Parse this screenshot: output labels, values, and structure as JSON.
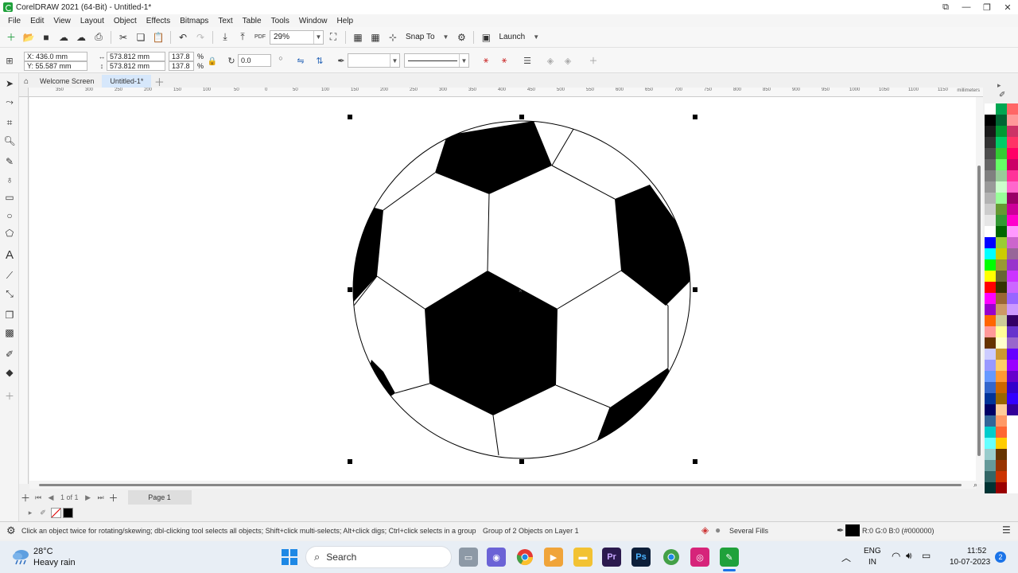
{
  "window": {
    "title": "CorelDRAW 2021 (64-Bit) - Untitled-1*"
  },
  "menu": [
    "File",
    "Edit",
    "View",
    "Layout",
    "Object",
    "Effects",
    "Bitmaps",
    "Text",
    "Table",
    "Tools",
    "Window",
    "Help"
  ],
  "toolbar": {
    "zoom": "29%",
    "snap_to": "Snap To",
    "launch": "Launch",
    "pdf": "PDF"
  },
  "properties": {
    "x": "X: 436.0 mm",
    "y": "Y: 55.587 mm",
    "width": "573.812 mm",
    "height": "573.812 mm",
    "scale_w": "137.8",
    "scale_h": "137.8",
    "pct": "%",
    "angle": "0.0"
  },
  "tabs": {
    "welcome": "Welcome Screen",
    "document": "Untitled-1*"
  },
  "ruler": {
    "labels": [
      "350",
      "300",
      "250",
      "200",
      "150",
      "100",
      "50",
      "0",
      "50",
      "100",
      "150",
      "200",
      "250",
      "300",
      "350",
      "400",
      "450",
      "500",
      "550",
      "600",
      "650",
      "700",
      "750",
      "800",
      "850",
      "900",
      "950",
      "1000",
      "1050",
      "1100",
      "1150"
    ],
    "unit": "millimeters"
  },
  "page_nav": {
    "count": "1 of 1",
    "page": "Page 1"
  },
  "status": {
    "hint": "Click an object twice for rotating/skewing; dbl-clicking tool selects all objects; Shift+click multi-selects; Alt+click digs; Ctrl+click selects in a group",
    "selection": "Group of 2 Objects on Layer 1",
    "fill": "Several Fills",
    "outline": "R:0 G:0 B:0 (#000000)"
  },
  "taskbar": {
    "temp": "28°C",
    "weather": "Heavy rain",
    "search": "Search",
    "lang1": "ENG",
    "lang2": "IN",
    "time": "11:52",
    "date": "10-07-2023",
    "notifications": "2"
  },
  "palette_colors": {
    "col1": [
      "#ffffff",
      "#000000",
      "#1a1a1a",
      "#333333",
      "#4d4d4d",
      "#666666",
      "#808080",
      "#999999",
      "#b3b3b3",
      "#cccccc",
      "#e6e6e6",
      "#ffffff",
      "#0000ff",
      "#00ffff",
      "#00ff00",
      "#ffff00",
      "#ff0000",
      "#ff00ff",
      "#9900cc",
      "#ff6600",
      "#ff9999",
      "#663300",
      "#ccccff",
      "#9999ff",
      "#6699ff",
      "#3366cc",
      "#003399",
      "#000066",
      "#336699",
      "#00cccc",
      "#66ffff",
      "#99cccc",
      "#669999",
      "#336666",
      "#003333"
    ],
    "col2": [
      "#00a651",
      "#006633",
      "#009933",
      "#00cc66",
      "#33cc33",
      "#66ff66",
      "#99cc99",
      "#ccffcc",
      "#99ff99",
      "#669933",
      "#339933",
      "#006600",
      "#99cc33",
      "#cccc00",
      "#999933",
      "#666633",
      "#333300",
      "#996633",
      "#cc9966",
      "#cccc99",
      "#ffff99",
      "#ffffcc",
      "#cc9933",
      "#ffcc66",
      "#ff9933",
      "#cc6600",
      "#996600",
      "#ffcc99",
      "#ff9966",
      "#ff6633",
      "#ffcc00",
      "#663300",
      "#993300",
      "#cc3300",
      "#990000"
    ],
    "col3": [
      "#ff6666",
      "#ff9999",
      "#cc3366",
      "#ff3366",
      "#ff0066",
      "#cc0066",
      "#ff3399",
      "#ff66cc",
      "#990066",
      "#cc0099",
      "#ff00cc",
      "#ff99ff",
      "#cc66cc",
      "#996699",
      "#9933cc",
      "#cc33ff",
      "#cc66ff",
      "#9966ff",
      "#cc99ff",
      "#330066",
      "#6633cc",
      "#9966cc",
      "#6600ff",
      "#9900ff",
      "#6600cc",
      "#3300cc",
      "#3300ff",
      "#330099",
      "#ffffff",
      "#ffffff",
      "#ffffff",
      "#ffffff",
      "#ffffff",
      "#ffffff",
      "#ffffff"
    ]
  }
}
